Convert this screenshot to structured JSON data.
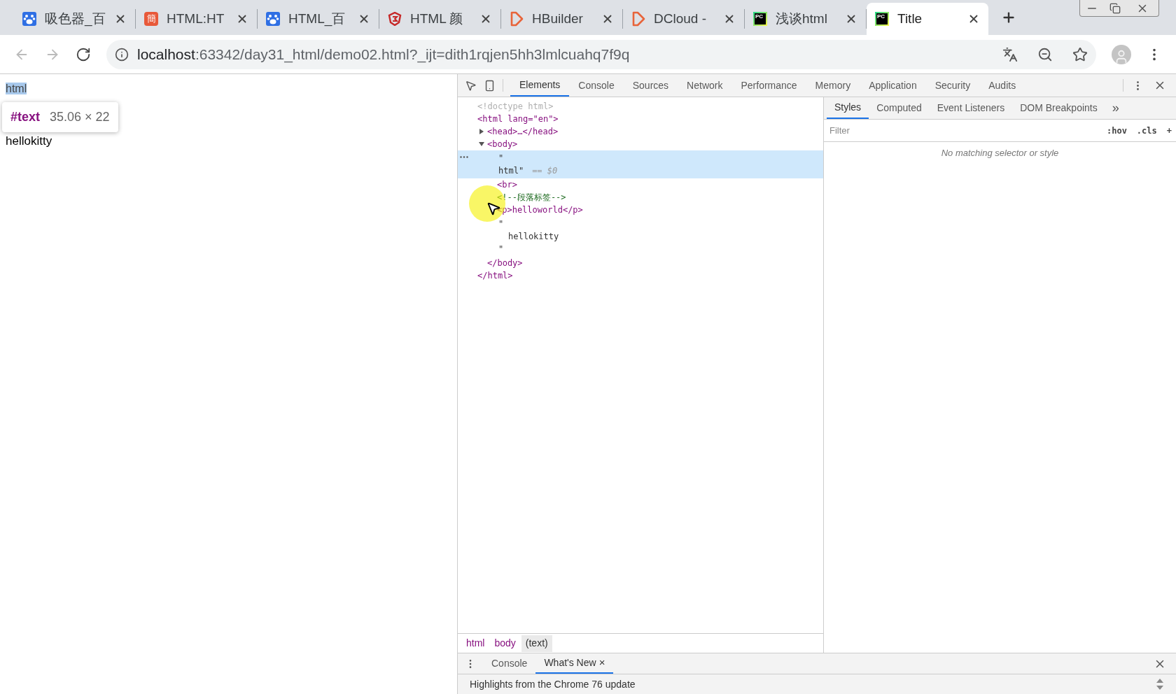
{
  "browser_tabs": [
    {
      "title": "吸色器_百",
      "kind": "paw",
      "selected": false
    },
    {
      "title": "HTML:HT",
      "kind": "square",
      "icon_text": "簡",
      "selected": false
    },
    {
      "title": "HTML_百",
      "kind": "paw",
      "selected": false
    },
    {
      "title": "HTML 颜",
      "kind": "shield",
      "selected": false
    },
    {
      "title": "HBuilder",
      "kind": "delta",
      "selected": false
    },
    {
      "title": "DCloud -",
      "kind": "delta",
      "selected": false
    },
    {
      "title": "浅谈html",
      "kind": "ide",
      "icon_text": "PC",
      "selected": false
    },
    {
      "title": "Title",
      "kind": "ide",
      "icon_text": "PC",
      "selected": true
    }
  ],
  "address": {
    "host": "localhost",
    "path": ":63342/day31_html/demo02.html?_ijt=dith1rqjen5hh3lmlcuahq7f9q"
  },
  "page": {
    "selected_text": "html",
    "tooltip": {
      "node": "#text",
      "size": "35.06 × 22"
    },
    "body_text": "hellokitty"
  },
  "devtools": {
    "tabs": [
      {
        "label": "Elements",
        "selected": true
      },
      {
        "label": "Console",
        "selected": false
      },
      {
        "label": "Sources",
        "selected": false
      },
      {
        "label": "Network",
        "selected": false
      },
      {
        "label": "Performance",
        "selected": false
      },
      {
        "label": "Memory",
        "selected": false
      },
      {
        "label": "Application",
        "selected": false
      },
      {
        "label": "Security",
        "selected": false
      },
      {
        "label": "Audits",
        "selected": false
      }
    ],
    "tree": [
      {
        "kind": "doctype",
        "text": "<!doctype html>",
        "selected": false
      },
      {
        "kind": "element",
        "text": "<html lang=\"en\">",
        "selected": false,
        "close": "</html>",
        "children": [
          {
            "kind": "element",
            "text": "<head>…</head>",
            "expanded": false,
            "selected": false
          },
          {
            "kind": "element",
            "text": "<body>",
            "expanded": true,
            "selected": false,
            "close": "</body>",
            "children": [
              {
                "kind": "text",
                "lines": [
                  "\"",
                  "html\""
                ],
                "marker": "== $0",
                "selected": true
              },
              {
                "kind": "element",
                "text": "<br>",
                "selected": false
              },
              {
                "kind": "comment",
                "text": "<!--段落标签-->",
                "selected": false
              },
              {
                "kind": "element",
                "text": "<p>helloworld</p>",
                "selected": false
              },
              {
                "kind": "text",
                "lines": [
                  "\"",
                  "hellokitty",
                  "\""
                ],
                "selected": false
              }
            ]
          }
        ]
      }
    ],
    "breadcrumbs": [
      {
        "label": "html",
        "selected": false
      },
      {
        "label": "body",
        "selected": false
      },
      {
        "label": "(text)",
        "selected": true
      }
    ],
    "styles_tabs": [
      {
        "label": "Styles",
        "selected": true
      },
      {
        "label": "Computed",
        "selected": false
      },
      {
        "label": "Event Listeners",
        "selected": false
      },
      {
        "label": "DOM Breakpoints",
        "selected": false
      }
    ],
    "styles_overflow": "»",
    "filter": {
      "placeholder": "Filter"
    },
    "filter_buttons": [
      ":hov",
      ".cls",
      "+"
    ],
    "styles_empty": "No matching selector or style",
    "drawer": {
      "tabs": [
        {
          "label": "Console",
          "selected": false,
          "closable": false
        },
        {
          "label": "What's New",
          "selected": true,
          "closable": true
        }
      ],
      "close_glyph": "×",
      "content": "Highlights from the Chrome 76 update"
    }
  }
}
